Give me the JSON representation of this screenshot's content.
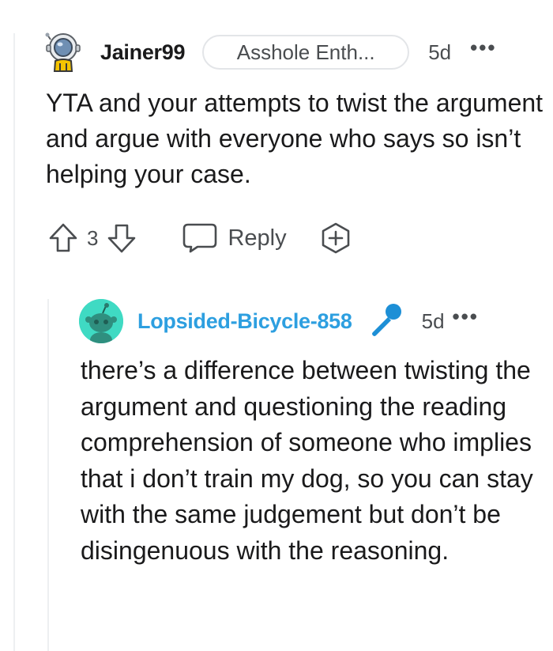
{
  "comments": [
    {
      "username": "Jainer99",
      "flair": "Asshole Enth...",
      "age": "5d",
      "more_label": "•••",
      "body": "YTA and your attempts to twist the argument and argue with everyone who says so isn’t helping your case.",
      "score": "3",
      "reply_label": "Reply",
      "icons": {
        "upvote": "upvote-arrow-icon",
        "downvote": "downvote-arrow-icon",
        "reply": "speech-bubble-icon",
        "award": "award-plus-icon",
        "avatar": "astronaut-snoo-avatar"
      }
    },
    {
      "username": "Lopsided-Bicycle-858",
      "age": "5d",
      "more_label": "•••",
      "body": "there’s a difference between twisting the argument and questioning the reading comprehension of someone who implies that i don’t train my dog, so you can stay with the same judgement but don’t be disingenuous with the reasoning.",
      "badge_icon": "microphone-icon",
      "colors": {
        "username": "#2d9fe0",
        "avatar_bg": "#3fdac3"
      }
    }
  ]
}
